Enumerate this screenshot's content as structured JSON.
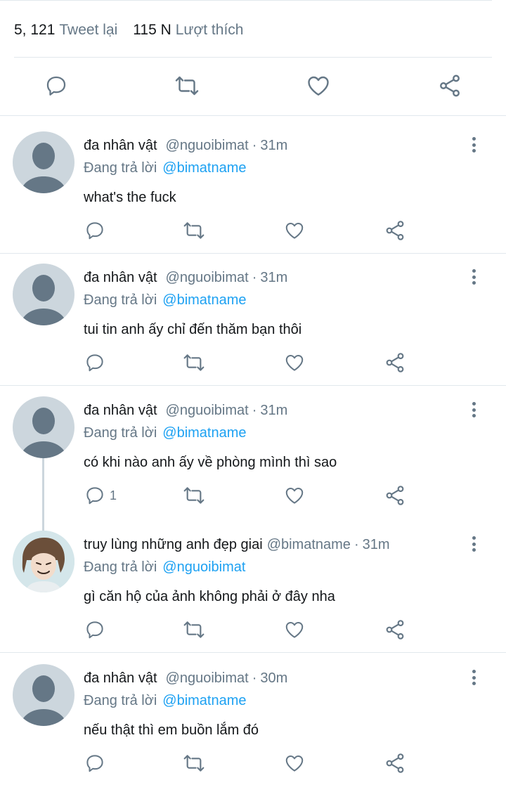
{
  "stats": {
    "retweet_count": "5, 121",
    "retweet_label": "Tweet lại",
    "like_count": "115 N",
    "like_label": "Lượt thích"
  },
  "main_actions": [
    "reply-icon",
    "retweet-icon",
    "like-icon",
    "share-icon"
  ],
  "colors": {
    "text": "#14171a",
    "secondary": "#657786",
    "link": "#1da1f2",
    "divider": "#e1e8ed",
    "avatar_placeholder": "#ccd6dd"
  },
  "replies": [
    {
      "name": "đa nhân vật",
      "handle": "@nguoibimat",
      "sep": "·",
      "time": "31m",
      "reply_prefix": "Đang trả lời",
      "reply_to": "@bimatname",
      "text": "what's the fuck",
      "reply_count": ""
    },
    {
      "name": "đa nhân vật",
      "handle": "@nguoibimat",
      "sep": "·",
      "time": "31m",
      "reply_prefix": "Đang trả lời",
      "reply_to": "@bimatname",
      "text": "tui tin anh ấy chỉ đến thăm bạn thôi",
      "reply_count": ""
    },
    {
      "name": "đa nhân vật",
      "handle": "@nguoibimat",
      "sep": "·",
      "time": "31m",
      "reply_prefix": "Đang trả lời",
      "reply_to": "@bimatname",
      "text": "có khi nào anh ấy về phòng mình thì sao",
      "reply_count": "1"
    },
    {
      "name": "truy lùng những anh đẹp giai",
      "handle": "@bimatname",
      "sep": "·",
      "time": "31m",
      "reply_prefix": "Đang trả lời",
      "reply_to": "@nguoibimat",
      "text": "gì căn hộ của ảnh không phải ở đây nha",
      "reply_count": ""
    },
    {
      "name": "đa nhân vật",
      "handle": "@nguoibimat",
      "sep": "·",
      "time": "30m",
      "reply_prefix": "Đang trả lời",
      "reply_to": "@bimatname",
      "text": "nếu thật thì em buồn lắm đó",
      "reply_count": ""
    }
  ]
}
